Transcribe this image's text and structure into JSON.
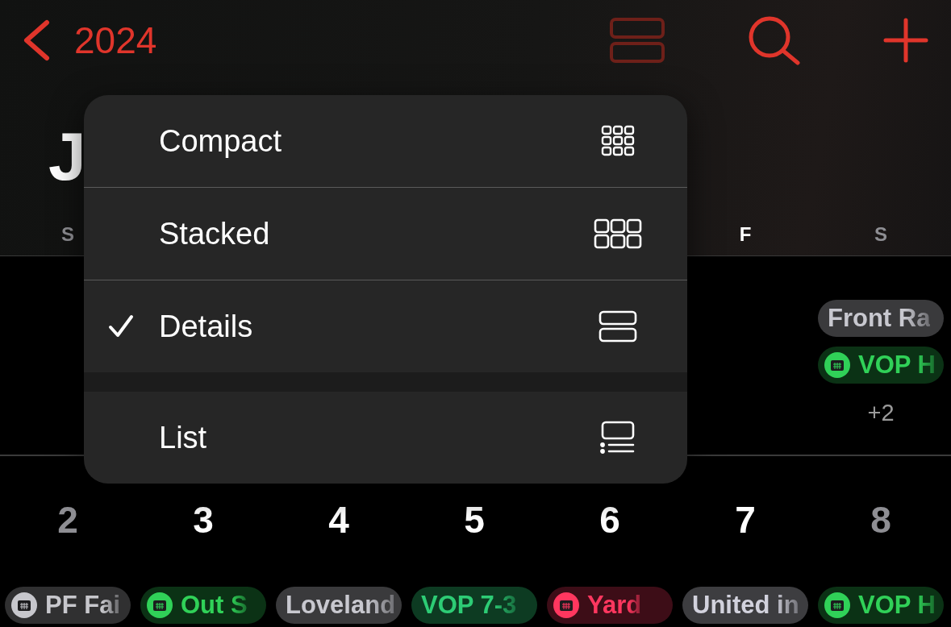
{
  "header": {
    "back_label": "2024"
  },
  "month_title": "J",
  "weekdays": {
    "start": [
      {
        "label": "S",
        "weekend": true
      }
    ],
    "end": [
      {
        "label": "F",
        "weekend": false
      },
      {
        "label": "S",
        "weekend": true
      }
    ]
  },
  "first_week": {
    "end_cells": [
      {
        "events": [
          {
            "title": "Front Ra",
            "kind": "plain",
            "color": "#3a3a3c"
          },
          {
            "title": "VOP H",
            "kind": "calendar",
            "color": "#30d158"
          }
        ],
        "more": "+2"
      }
    ]
  },
  "second_week": {
    "cells": [
      {
        "number": "2",
        "weekend": true,
        "events": [
          {
            "title": "PF Fai",
            "kind": "calendar",
            "color": "#c7c7cc"
          }
        ]
      },
      {
        "number": "3",
        "weekend": false,
        "events": [
          {
            "title": "Out S",
            "kind": "calendar",
            "color": "#30d158"
          }
        ]
      },
      {
        "number": "4",
        "weekend": false,
        "events": [
          {
            "title": "Loveland",
            "kind": "plain",
            "color": "#3a3a3c"
          }
        ]
      },
      {
        "number": "5",
        "weekend": false,
        "events": [
          {
            "title": "VOP 7-3",
            "kind": "plain",
            "color": "#0d3b22"
          }
        ]
      },
      {
        "number": "6",
        "weekend": false,
        "events": [
          {
            "title": "Yard",
            "kind": "calendar",
            "color": "#ff375f"
          }
        ]
      },
      {
        "number": "7",
        "weekend": false,
        "events": [
          {
            "title": "United in",
            "kind": "plain",
            "color": "#3d3d40"
          }
        ]
      },
      {
        "number": "8",
        "weekend": true,
        "events": [
          {
            "title": "VOP H",
            "kind": "calendar",
            "color": "#30d158"
          }
        ]
      }
    ]
  },
  "view_menu": {
    "items": [
      {
        "label": "Compact",
        "checked": false,
        "new_section": false
      },
      {
        "label": "Stacked",
        "checked": false,
        "new_section": false
      },
      {
        "label": "Details",
        "checked": true,
        "new_section": false
      },
      {
        "label": "List",
        "checked": false,
        "new_section": true
      }
    ]
  }
}
